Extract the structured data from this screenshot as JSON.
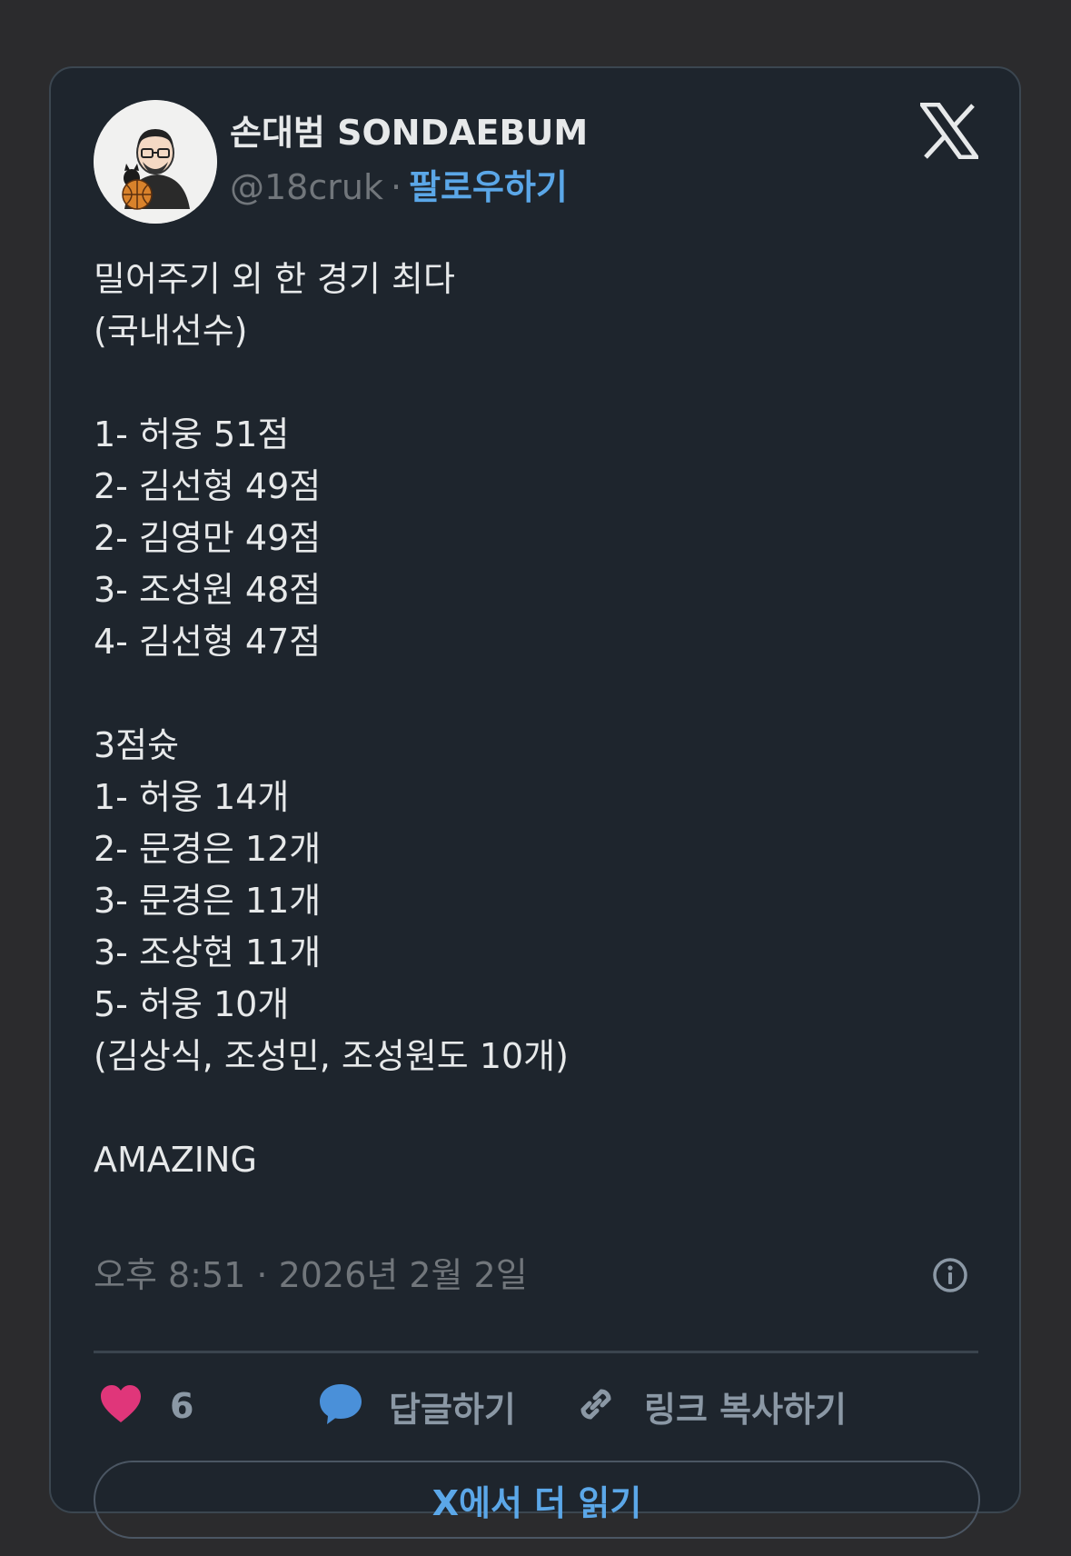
{
  "author": {
    "display_name": "손대범 SONDAEBUM",
    "handle": "@18cruk",
    "separator": "·",
    "follow_label": "팔로우하기"
  },
  "tweet": {
    "lines": [
      "밀어주기 외 한 경기 최다",
      "(국내선수)",
      "",
      "1- 허웅 51점",
      "2- 김선형 49점",
      "2- 김영만 49점",
      "3- 조성원 48점",
      "4- 김선형 47점",
      "",
      "3점슛",
      "1- 허웅 14개",
      "2- 문경은 12개",
      "3- 문경은 11개",
      "3- 조상현 11개",
      "5- 허웅 10개",
      "(김상식, 조성민, 조성원도 10개)",
      "",
      "AMAZING"
    ]
  },
  "timestamp": "오후 8:51 · 2026년 2월 2일",
  "actions": {
    "like_count": "6",
    "reply_label": "답글하기",
    "copy_link_label": "링크 복사하기"
  },
  "read_more_label": "X에서 더 읽기",
  "icons": {
    "logo": "x-logo-icon",
    "like": "heart-icon",
    "reply": "speech-bubble-icon",
    "copy_link": "link-icon",
    "info": "info-icon"
  },
  "colors": {
    "card_bg": "#1e252d",
    "page_bg": "#2b2b2d",
    "text": "#e7e9ea",
    "muted": "#71767b",
    "accent": "#5ba7e8",
    "heart": "#e0367a",
    "reply_bubble": "#4a90d9"
  }
}
